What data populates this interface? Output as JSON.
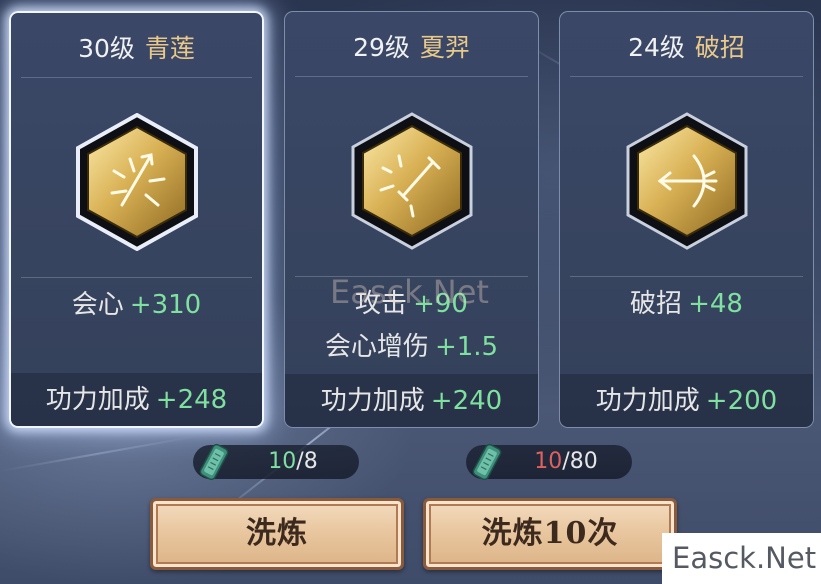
{
  "cards": [
    {
      "level": "30级",
      "name": "青莲",
      "stats": [
        {
          "label": "会心",
          "value": "+310"
        }
      ],
      "bonus": {
        "label": "功力加成",
        "value": "+248"
      }
    },
    {
      "level": "29级",
      "name": "夏羿",
      "stats": [
        {
          "label": "攻击",
          "value": "+90"
        },
        {
          "label": "会心增伤",
          "value": "+1.5"
        }
      ],
      "bonus": {
        "label": "功力加成",
        "value": "+240"
      }
    },
    {
      "level": "24级",
      "name": "破招",
      "stats": [
        {
          "label": "破招",
          "value": "+48"
        }
      ],
      "bonus": {
        "label": "功力加成",
        "value": "+200"
      }
    }
  ],
  "costs": [
    {
      "have": "10",
      "need": "/8",
      "sufficient": true
    },
    {
      "have": "10",
      "need": "/80",
      "sufficient": false
    }
  ],
  "buttons": {
    "refine": "洗炼",
    "refine10": "洗炼10次"
  },
  "watermarks": {
    "middle": "Easck.Net",
    "corner": "Easck.Net"
  },
  "colors": {
    "stat_value": "#7fe0a0",
    "insufficient": "#e06060",
    "name_gold": "#e9c98a"
  },
  "icons": {
    "card1": "gold-hex-burst-arrow-icon",
    "card2": "gold-hex-sword-burst-icon",
    "card3": "gold-hex-bow-arrow-icon",
    "currency": "jade-tablet-icon"
  }
}
